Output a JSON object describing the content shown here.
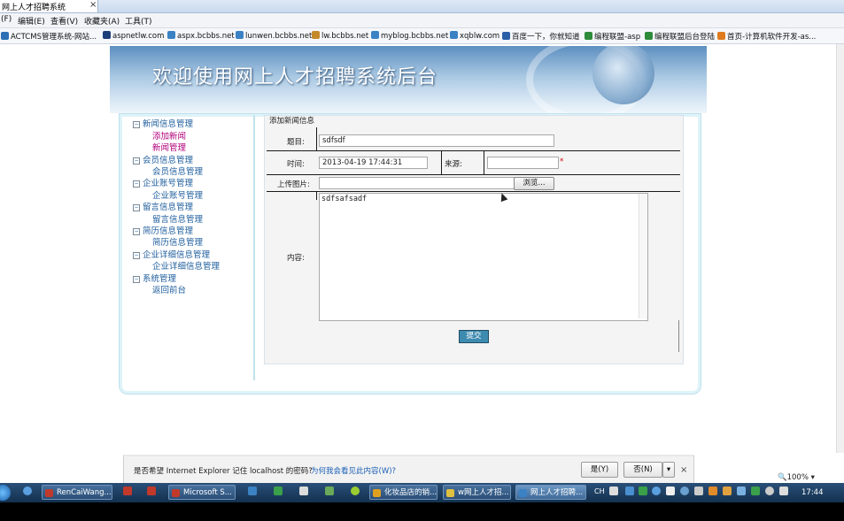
{
  "window": {
    "tab_title": "网上人才招聘系统",
    "tab_close": "×"
  },
  "menu": [
    "(F)",
    "编辑(E)",
    "查看(V)",
    "收藏夹(A)",
    "工具(T)"
  ],
  "favorites": [
    {
      "label": "ACTCMS管理系统-网站...",
      "color": "#2c6fb5"
    },
    {
      "label": "aspnetlw.com",
      "color": "#1d3f7a"
    },
    {
      "label": "aspx.bcbbs.net",
      "color": "#3b82c4"
    },
    {
      "label": "lunwen.bcbbs.net",
      "color": "#3b82c4"
    },
    {
      "label": "lw.bcbbs.net",
      "color": "#c48a2a"
    },
    {
      "label": "myblog.bcbbs.net",
      "color": "#3b82c4"
    },
    {
      "label": "xqblw.com",
      "color": "#3b82c4"
    },
    {
      "label": "百度一下，你就知道",
      "color": "#2c5ea8"
    },
    {
      "label": "编程联盟-asp",
      "color": "#2e8b3a"
    },
    {
      "label": "编程联盟后台登陆",
      "color": "#2e8b3a"
    },
    {
      "label": "首页-计算机软件开发-as...",
      "color": "#e07a1e"
    }
  ],
  "banner": {
    "title": "欢迎使用网上人才招聘系统后台"
  },
  "sidebar": {
    "groups": [
      {
        "label": "新闻信息管理",
        "items": [
          "添加新闻",
          "新闻管理"
        ]
      },
      {
        "label": "会员信息管理",
        "items": [
          "会员信息管理"
        ]
      },
      {
        "label": "企业账号管理",
        "items": [
          "企业账号管理"
        ]
      },
      {
        "label": "留言信息管理",
        "items": [
          "留言信息管理"
        ]
      },
      {
        "label": "简历信息管理",
        "items": [
          "简历信息管理"
        ]
      },
      {
        "label": "企业详细信息管理",
        "items": [
          "企业详细信息管理"
        ]
      },
      {
        "label": "系统管理",
        "items": [
          "返回前台"
        ]
      }
    ],
    "minus_glyph": "−"
  },
  "form": {
    "title": "添加新闻信息",
    "subject_label": "题目:",
    "subject_value": "sdfsdf",
    "time_label": "时间:",
    "time_value": "2013-04-19 17:44:31",
    "source_label": "来源:",
    "source_value": "",
    "required_mark": "*",
    "upload_label": "上传图片:",
    "browse_label": "浏览...",
    "content_label": "内容:",
    "content_value": "sdfsafsadf",
    "submit_label": "提交"
  },
  "notification": {
    "question": "是否希望 Internet Explorer 记住 localhost 的密码?",
    "link": "为何我会看见此内容(W)?",
    "yes": "是(Y)",
    "no": "否(N)",
    "dropdown": "▾",
    "close": "×"
  },
  "zoom": {
    "label": "100%",
    "icon": "magnifier-icon",
    "dropdown": "▾"
  },
  "taskbar": {
    "apps": [
      {
        "label": "RenCaiWang...",
        "color": "#c0392b"
      },
      {
        "label": "Microsoft S...",
        "color": "#c0392b"
      },
      {
        "label": "化妆品店的销...",
        "color": "#e0a020"
      },
      {
        "label": "w网上人才招...",
        "color": "#e0c040"
      },
      {
        "label": "网上人才招聘...",
        "color": "#3b82c4",
        "active": true
      }
    ],
    "tray_text": "CH",
    "clock": "17:44"
  }
}
